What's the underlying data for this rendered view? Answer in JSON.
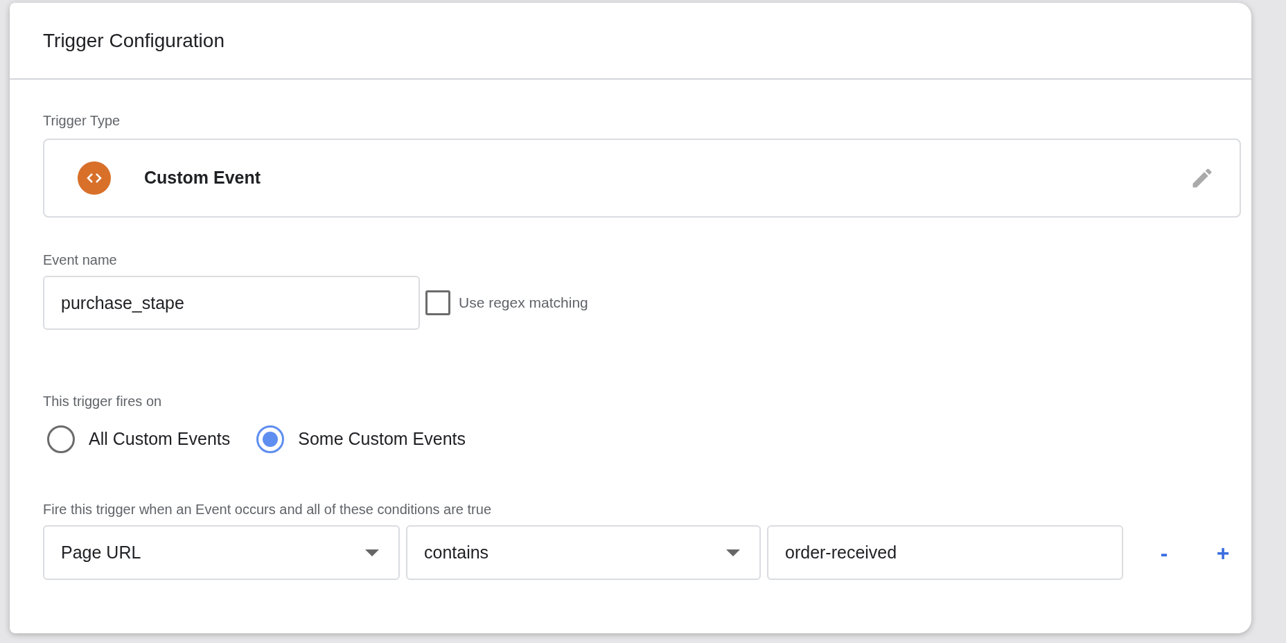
{
  "panel": {
    "title": "Trigger Configuration"
  },
  "trigger_type": {
    "label": "Trigger Type",
    "value": "Custom Event"
  },
  "event_name": {
    "label": "Event name",
    "value": "purchase_stape",
    "regex": {
      "label": "Use regex matching",
      "checked": false
    }
  },
  "fires_on": {
    "label": "This trigger fires on",
    "options": [
      {
        "label": "All Custom Events",
        "selected": false
      },
      {
        "label": "Some Custom Events",
        "selected": true
      }
    ]
  },
  "conditions": {
    "label": "Fire this trigger when an Event occurs and all of these conditions are true",
    "rows": [
      {
        "variable": "Page URL",
        "operator": "contains",
        "value": "order-received",
        "remove": "-",
        "add": "+"
      }
    ]
  }
}
